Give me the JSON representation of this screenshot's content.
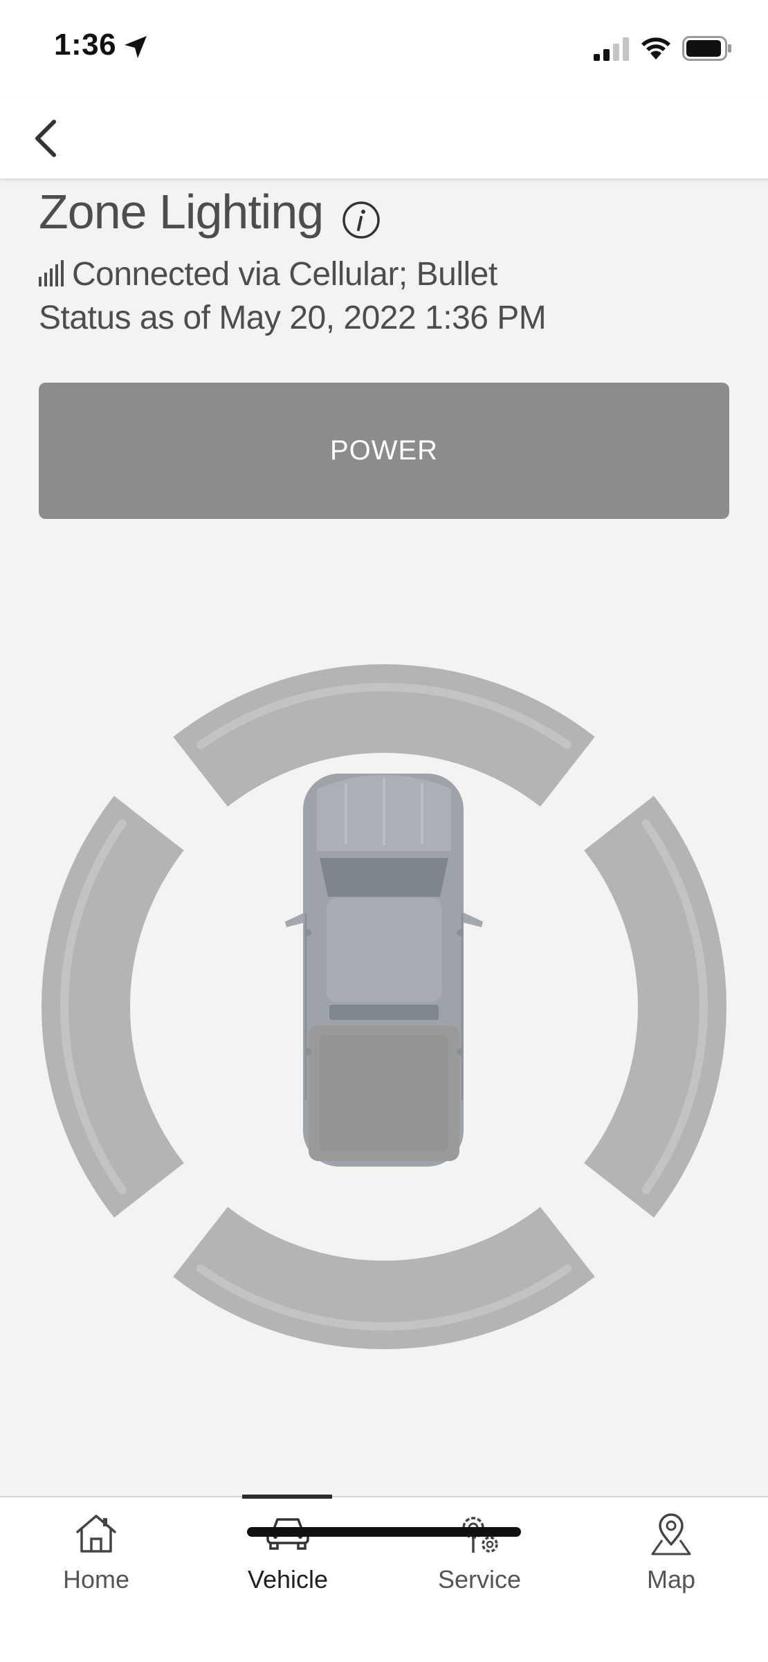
{
  "status_bar": {
    "time": "1:36"
  },
  "header": {
    "title": "Zone Lighting",
    "connection": "Connected via Cellular; Bullet",
    "status": "Status as of May 20, 2022 1:36 PM"
  },
  "power_button": {
    "label": "POWER"
  },
  "tabs": [
    {
      "label": "Home",
      "icon": "home-icon"
    },
    {
      "label": "Vehicle",
      "icon": "vehicle-icon",
      "active": true
    },
    {
      "label": "Service",
      "icon": "service-gear-icon"
    },
    {
      "label": "Map",
      "icon": "map-pin-icon"
    }
  ],
  "colors": {
    "power_button_bg": "#8c8c8c",
    "zone_inactive": "#b4b4b4",
    "truck_body": "#9ea3a9"
  }
}
